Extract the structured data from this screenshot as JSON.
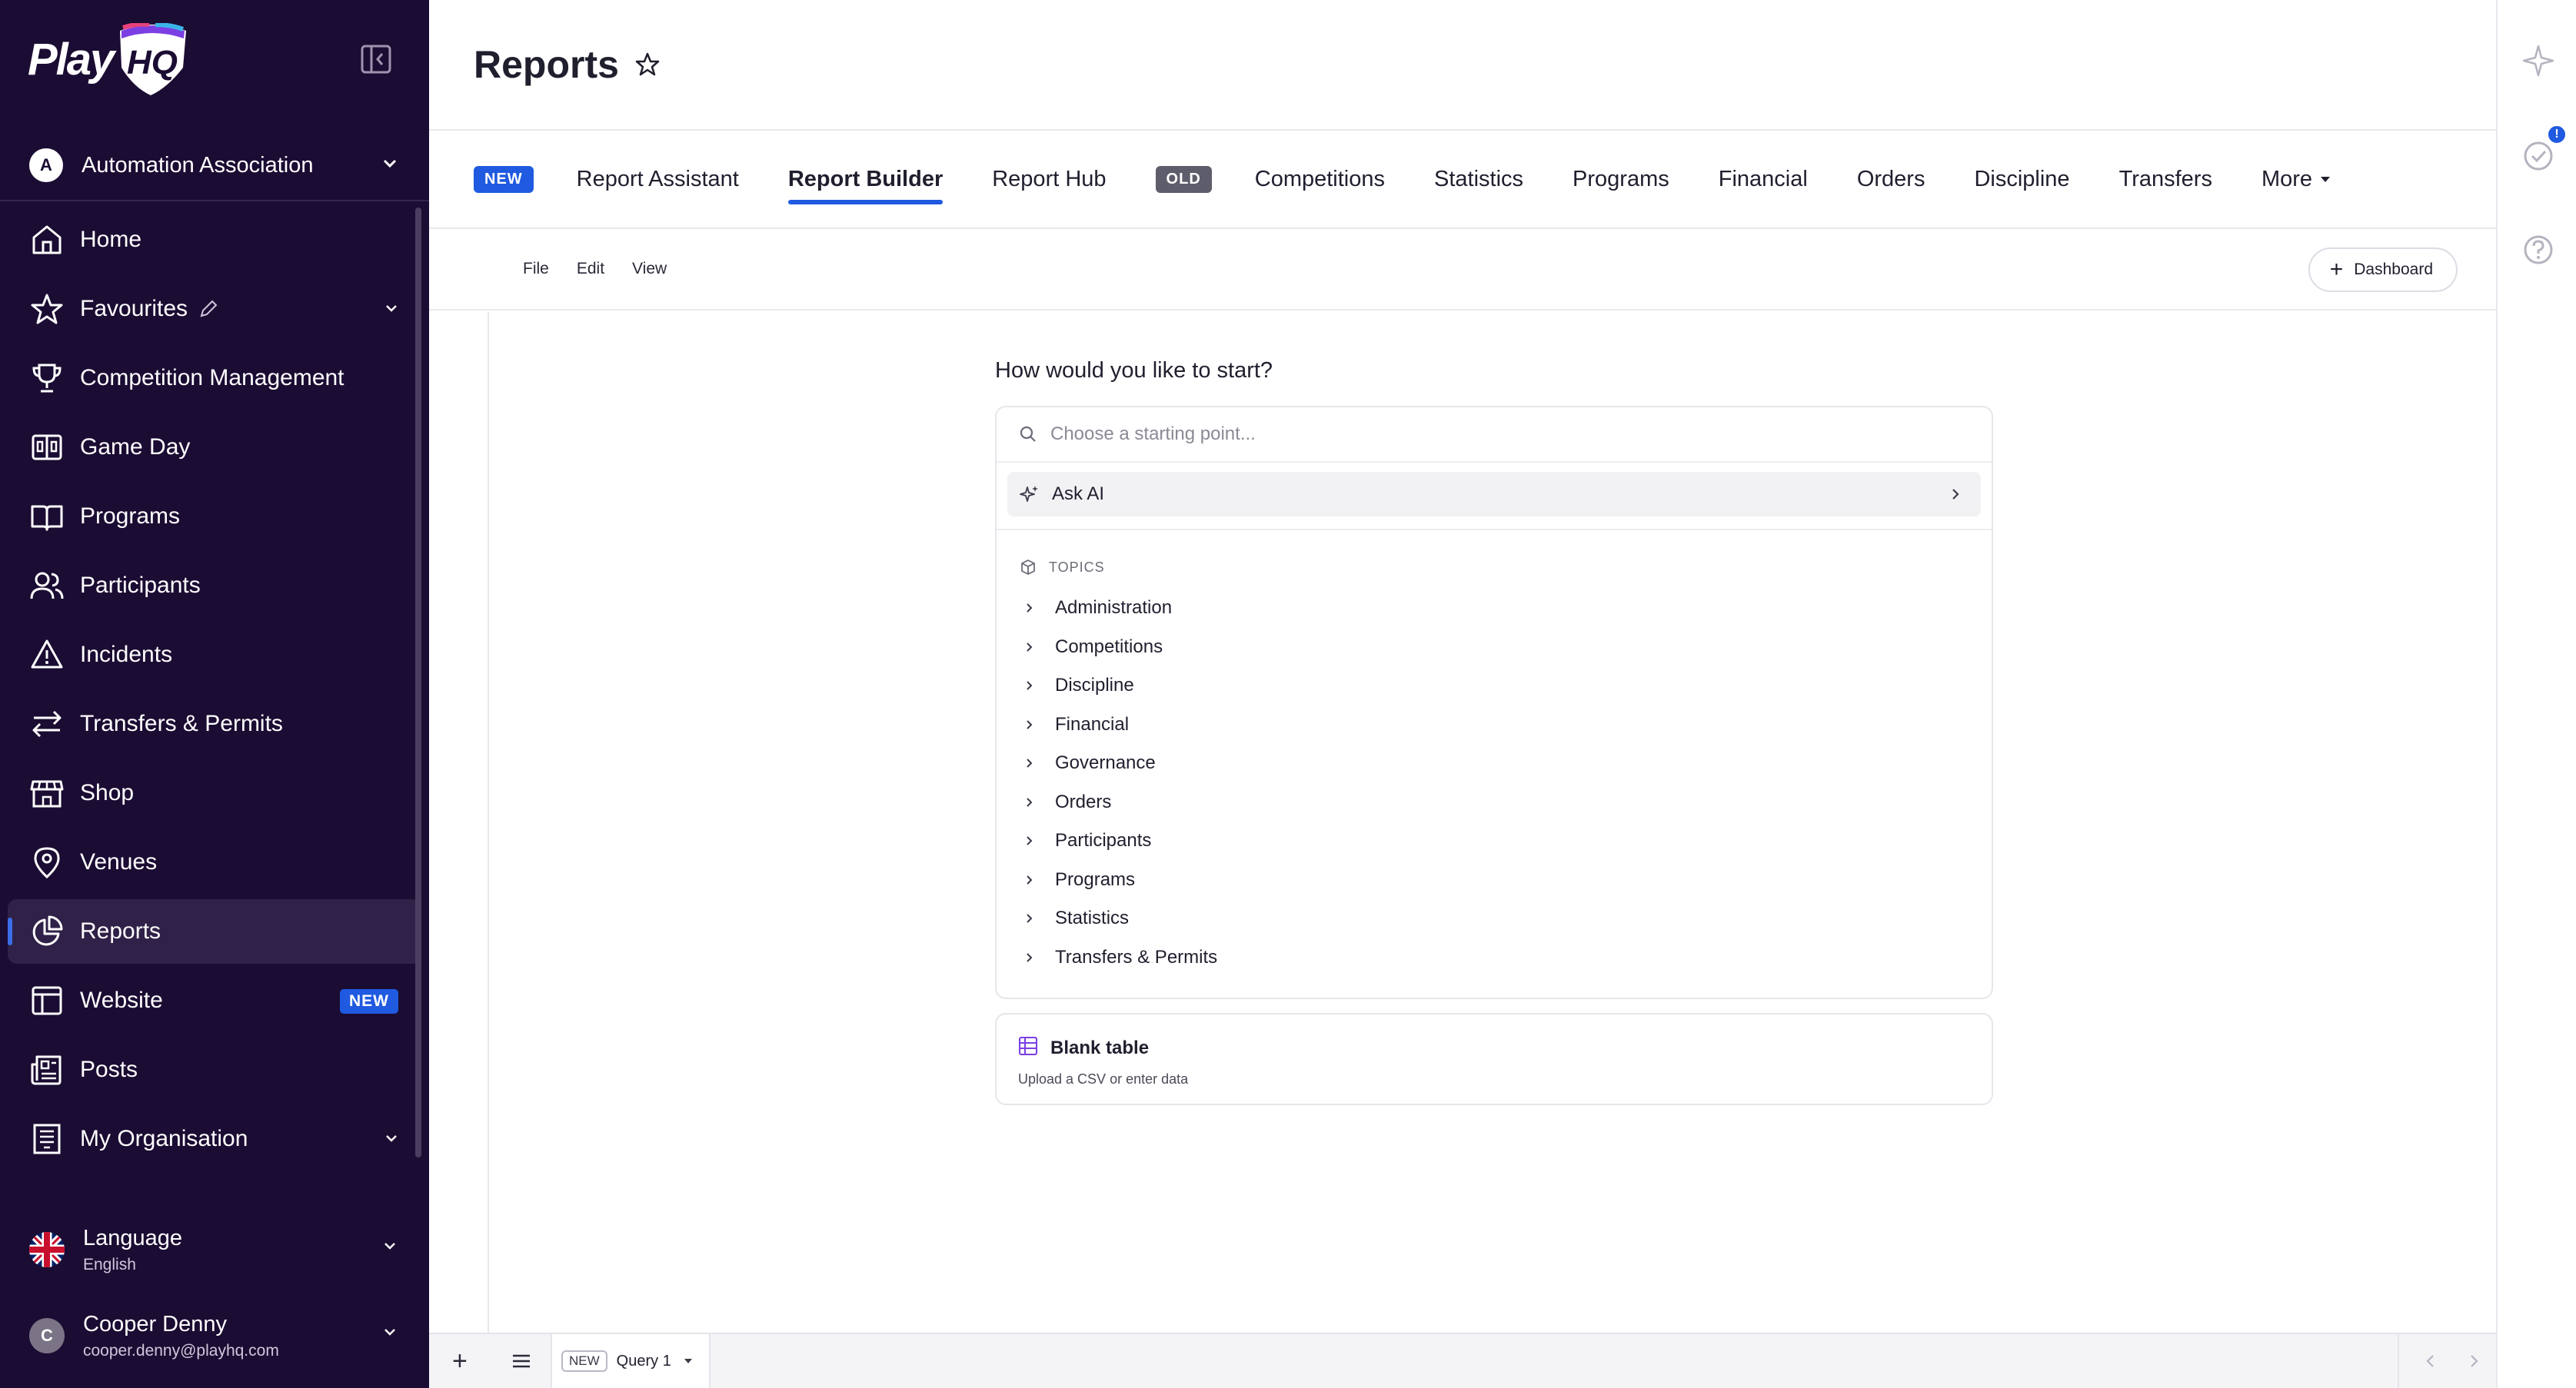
{
  "app": {
    "logo_text": "Play",
    "logo_mark": "HQ"
  },
  "sidebar": {
    "org": {
      "initial": "A",
      "name": "Automation Association"
    },
    "items": [
      {
        "label": "Home",
        "icon": "home-icon"
      },
      {
        "label": "Favourites",
        "icon": "star-icon"
      },
      {
        "label": "Competition Management",
        "icon": "trophy-icon"
      },
      {
        "label": "Game Day",
        "icon": "scoreboard-icon"
      },
      {
        "label": "Programs",
        "icon": "book-icon"
      },
      {
        "label": "Participants",
        "icon": "users-icon"
      },
      {
        "label": "Incidents",
        "icon": "warning-icon"
      },
      {
        "label": "Transfers & Permits",
        "icon": "transfer-icon"
      },
      {
        "label": "Shop",
        "icon": "store-icon"
      },
      {
        "label": "Venues",
        "icon": "location-icon"
      },
      {
        "label": "Reports",
        "icon": "pie-chart-icon"
      },
      {
        "label": "Website",
        "icon": "layout-icon",
        "badge": "NEW"
      },
      {
        "label": "Posts",
        "icon": "newspaper-icon"
      },
      {
        "label": "My Organisation",
        "icon": "building-icon"
      }
    ],
    "language": {
      "title": "Language",
      "value": "English"
    },
    "user": {
      "initial": "C",
      "name": "Cooper Denny",
      "email": "cooper.denny@playhq.com"
    }
  },
  "header": {
    "title": "Reports"
  },
  "tabs": {
    "new_tag": "NEW",
    "old_tag": "OLD",
    "report_assistant": "Report Assistant",
    "report_builder": "Report Builder",
    "report_hub": "Report Hub",
    "competitions": "Competitions",
    "statistics": "Statistics",
    "programs": "Programs",
    "financial": "Financial",
    "orders": "Orders",
    "discipline": "Discipline",
    "transfers": "Transfers",
    "more": "More"
  },
  "toolbar": {
    "file": "File",
    "edit": "Edit",
    "view": "View",
    "dashboard": "Dashboard"
  },
  "builder": {
    "prompt": "How would you like to start?",
    "search_placeholder": "Choose a starting point...",
    "ask_ai": "Ask AI",
    "topics_heading": "TOPICS",
    "topics": [
      "Administration",
      "Competitions",
      "Discipline",
      "Financial",
      "Governance",
      "Orders",
      "Participants",
      "Programs",
      "Statistics",
      "Transfers & Permits"
    ],
    "blank_title": "Blank table",
    "blank_sub": "Upload a CSV or enter data"
  },
  "bottom_bar": {
    "new_tag": "NEW",
    "query_name": "Query 1"
  },
  "right_rail": {
    "badge": "!"
  },
  "colors": {
    "sidebar_bg": "#1b0c33",
    "accent": "#1f5ae0",
    "old_tag": "#5d5d6b"
  }
}
